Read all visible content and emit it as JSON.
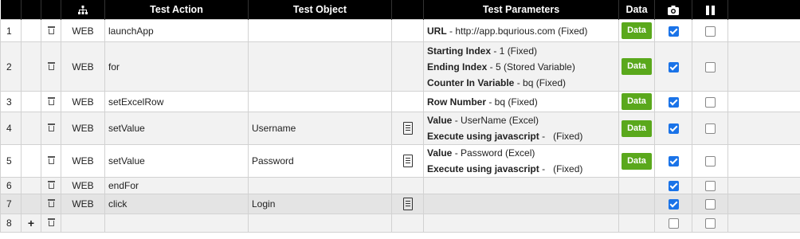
{
  "header": {
    "test_action": "Test Action",
    "test_object": "Test Object",
    "test_parameters": "Test Parameters",
    "data": "Data"
  },
  "data_button_label": "Data",
  "rows": [
    {
      "num": "1",
      "type": "WEB",
      "action": "launchApp",
      "object": "",
      "params": [
        {
          "k": "URL",
          "v": " - http://app.bqurious.com (Fixed)"
        }
      ],
      "has_data": true,
      "has_doc": false,
      "shot": true,
      "pause": false
    },
    {
      "num": "2",
      "type": "WEB",
      "action": "for",
      "object": "",
      "params": [
        {
          "k": "Starting Index",
          "v": " - 1 (Fixed)"
        },
        {
          "k": "Ending Index",
          "v": " - 5 (Stored Variable)"
        },
        {
          "k": "Counter In Variable",
          "v": " - bq (Fixed)"
        }
      ],
      "has_data": true,
      "has_doc": false,
      "shot": true,
      "pause": false
    },
    {
      "num": "3",
      "type": "WEB",
      "action": "setExcelRow",
      "object": "",
      "params": [
        {
          "k": "Row Number",
          "v": " - bq (Fixed)"
        }
      ],
      "has_data": true,
      "has_doc": false,
      "shot": true,
      "pause": false
    },
    {
      "num": "4",
      "type": "WEB",
      "action": "setValue",
      "object": "Username",
      "params": [
        {
          "k": "Value",
          "v": " - UserName (Excel)"
        },
        {
          "k": "Execute using javascript",
          "v": " -   (Fixed)"
        }
      ],
      "has_data": true,
      "has_doc": true,
      "shot": true,
      "pause": false
    },
    {
      "num": "5",
      "type": "WEB",
      "action": "setValue",
      "object": "Password",
      "params": [
        {
          "k": "Value",
          "v": " - Password (Excel)"
        },
        {
          "k": "Execute using javascript",
          "v": " -   (Fixed)"
        }
      ],
      "has_data": true,
      "has_doc": true,
      "shot": true,
      "pause": false
    },
    {
      "num": "6",
      "type": "WEB",
      "action": "endFor",
      "object": "",
      "params": [],
      "has_data": false,
      "has_doc": false,
      "shot": true,
      "pause": false
    },
    {
      "num": "7",
      "type": "WEB",
      "action": "click",
      "object": "Login",
      "params": [],
      "has_data": false,
      "has_doc": true,
      "shot": true,
      "pause": false,
      "selected": true
    },
    {
      "num": "8",
      "type": "",
      "action": "",
      "object": "",
      "params": [],
      "has_data": false,
      "has_doc": false,
      "shot": false,
      "pause": false,
      "add": true
    }
  ],
  "row_heights": [
    28,
    62,
    26,
    41,
    41,
    21,
    25,
    23
  ],
  "colors": {
    "header_bg": "#000000",
    "data_button": "#5aa81c",
    "checkbox_on": "#1a73e8"
  },
  "icons": {
    "hierarchy": "hierarchy-icon",
    "camera": "camera-icon",
    "pause": "pause-icon",
    "trash": "trash-icon",
    "doc": "document-icon",
    "add": "plus-icon"
  }
}
